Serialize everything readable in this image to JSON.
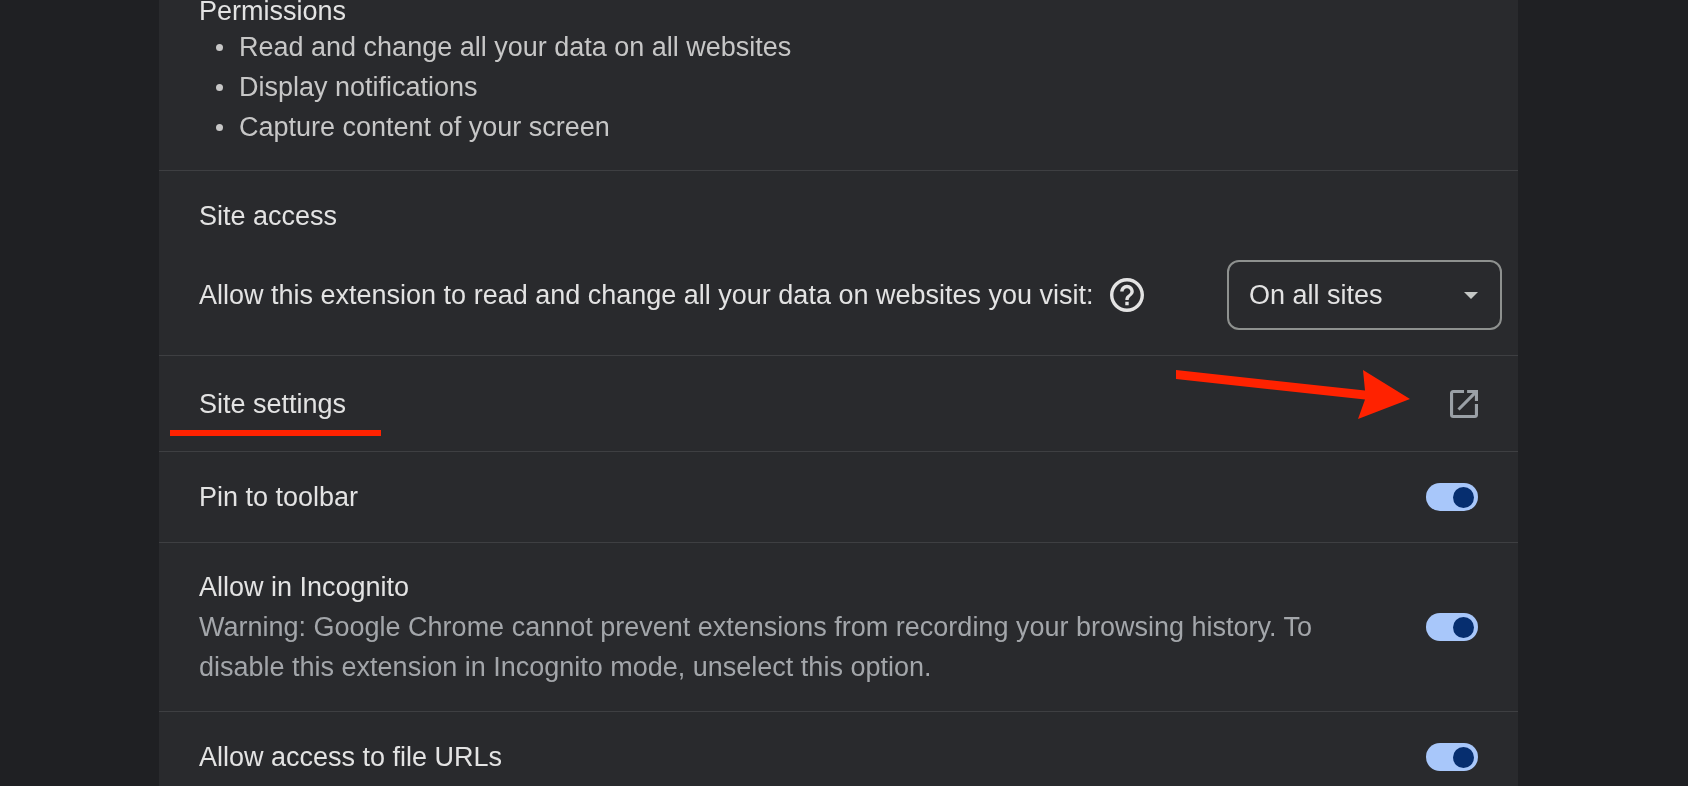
{
  "permissions": {
    "title": "Permissions",
    "items": [
      "Read and change all your data on all websites",
      "Display notifications",
      "Capture content of your screen"
    ]
  },
  "site_access": {
    "title": "Site access",
    "prompt": "Allow this extension to read and change all your data on websites you visit:",
    "dropdown": {
      "value": "On all sites"
    }
  },
  "rows": [
    {
      "kind": "link",
      "title": "Site settings",
      "underline_mark": true,
      "arrow_mark": true
    },
    {
      "kind": "toggle",
      "title": "Pin to toolbar",
      "on": true
    },
    {
      "kind": "toggle",
      "title": "Allow in Incognito",
      "description": "Warning: Google Chrome cannot prevent extensions from recording your browsing history. To disable this extension in Incognito mode, unselect this option.",
      "on": true
    },
    {
      "kind": "toggle",
      "title": "Allow access to file URLs",
      "on": true
    }
  ]
}
